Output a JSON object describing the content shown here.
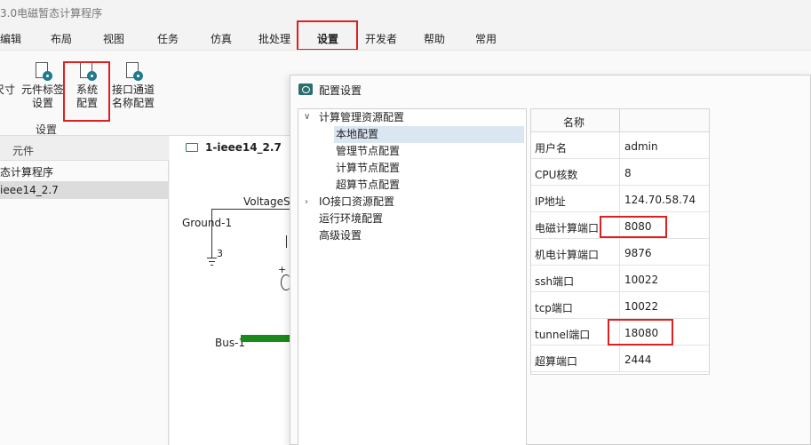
{
  "window": {
    "title": "3.0电磁暂态计算程序"
  },
  "menu": {
    "items": [
      "编辑",
      "布局",
      "视图",
      "任务",
      "仿真",
      "批处理",
      "设置",
      "开发者",
      "帮助",
      "常用"
    ],
    "active_index": 6
  },
  "ribbon": {
    "buttons": [
      {
        "line1": "尺寸",
        "line2": ""
      },
      {
        "line1": "元件标签",
        "line2": "设置"
      },
      {
        "line1": "系统",
        "line2": "配置"
      },
      {
        "line1": "接口通道",
        "line2": "名称配置"
      }
    ],
    "group_label": "设置"
  },
  "left_panel": {
    "header": "元件",
    "rows": [
      {
        "label": "态计算程序",
        "selected": false
      },
      {
        "label": "ieee14_2.7",
        "selected": true
      }
    ]
  },
  "canvas": {
    "tab_label": "1-ieee14_2.7",
    "labels": {
      "voltage": "VoltageS",
      "ground": "Ground-1",
      "ground_node": "3",
      "bus": "Bus-1"
    },
    "colors": {
      "bus": "#1a8a1a"
    }
  },
  "dialog": {
    "title": "配置设置",
    "tree": [
      {
        "label": "计算管理资源配置",
        "level": 0,
        "expanded": true,
        "has_children": true,
        "selected": false
      },
      {
        "label": "本地配置",
        "level": 1,
        "selected": true
      },
      {
        "label": "管理节点配置",
        "level": 1,
        "selected": false
      },
      {
        "label": "计算节点配置",
        "level": 1,
        "selected": false
      },
      {
        "label": "超算节点配置",
        "level": 1,
        "selected": false
      },
      {
        "label": "IO接口资源配置",
        "level": 0,
        "expanded": false,
        "has_children": true,
        "selected": false
      },
      {
        "label": "运行环境配置",
        "level": 0,
        "selected": false
      },
      {
        "label": "高级设置",
        "level": 0,
        "selected": false
      }
    ],
    "grid": {
      "header": "名称",
      "rows": [
        {
          "key": "用户名",
          "value": "admin"
        },
        {
          "key": "CPU核数",
          "value": "8"
        },
        {
          "key": "IP地址",
          "value": "124.70.58.74"
        },
        {
          "key": "电磁计算端口",
          "value": "8080"
        },
        {
          "key": "机电计算端口",
          "value": "9876"
        },
        {
          "key": "ssh端口",
          "value": "10022"
        },
        {
          "key": "tcp端口",
          "value": "10022"
        },
        {
          "key": "tunnel端口",
          "value": "18080"
        },
        {
          "key": "超算端口",
          "value": "2444"
        }
      ]
    }
  },
  "colors": {
    "highlight": "#e02020",
    "accent": "#1f7a8c"
  }
}
